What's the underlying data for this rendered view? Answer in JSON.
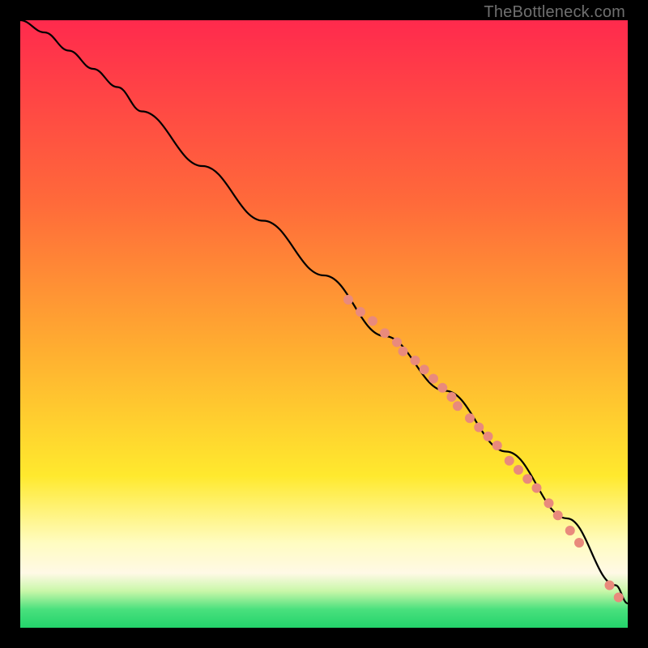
{
  "watermark": "TheBottleneck.com",
  "chart_data": {
    "type": "line",
    "title": "",
    "xlabel": "",
    "ylabel": "",
    "xlim": [
      0,
      100
    ],
    "ylim": [
      0,
      100
    ],
    "grid": false,
    "legend": false,
    "background_gradient": {
      "stops": [
        {
          "pct": 0,
          "color": "#ff2a4d"
        },
        {
          "pct": 30,
          "color": "#ff6a3a"
        },
        {
          "pct": 55,
          "color": "#ffb030"
        },
        {
          "pct": 75,
          "color": "#ffe92e"
        },
        {
          "pct": 86,
          "color": "#fffcc0"
        },
        {
          "pct": 91,
          "color": "#fff9e6"
        },
        {
          "pct": 94,
          "color": "#c8f7a8"
        },
        {
          "pct": 97,
          "color": "#49e07d"
        },
        {
          "pct": 100,
          "color": "#23d36b"
        }
      ]
    },
    "series": [
      {
        "name": "curve",
        "color": "#000000",
        "x": [
          0,
          4,
          8,
          12,
          16,
          20,
          30,
          40,
          50,
          60,
          70,
          80,
          90,
          98,
          100
        ],
        "y": [
          100,
          98,
          95,
          92,
          89,
          85,
          76,
          67,
          58,
          48,
          39,
          29,
          18,
          7,
          4
        ]
      }
    ],
    "markers": {
      "name": "highlighted-segments",
      "color": "#e98a7c",
      "radius_px": 6,
      "points": [
        {
          "x": 54,
          "y": 54
        },
        {
          "x": 56,
          "y": 52
        },
        {
          "x": 58,
          "y": 50.5
        },
        {
          "x": 60,
          "y": 48.5
        },
        {
          "x": 62,
          "y": 47
        },
        {
          "x": 63,
          "y": 45.5
        },
        {
          "x": 65,
          "y": 44
        },
        {
          "x": 66.5,
          "y": 42.5
        },
        {
          "x": 68,
          "y": 41
        },
        {
          "x": 69.5,
          "y": 39.5
        },
        {
          "x": 71,
          "y": 38
        },
        {
          "x": 72,
          "y": 36.5
        },
        {
          "x": 74,
          "y": 34.5
        },
        {
          "x": 75.5,
          "y": 33
        },
        {
          "x": 77,
          "y": 31.5
        },
        {
          "x": 78.5,
          "y": 30
        },
        {
          "x": 80.5,
          "y": 27.5
        },
        {
          "x": 82,
          "y": 26
        },
        {
          "x": 83.5,
          "y": 24.5
        },
        {
          "x": 85,
          "y": 23
        },
        {
          "x": 87,
          "y": 20.5
        },
        {
          "x": 88.5,
          "y": 18.5
        },
        {
          "x": 90.5,
          "y": 16
        },
        {
          "x": 92,
          "y": 14
        },
        {
          "x": 97,
          "y": 7
        },
        {
          "x": 98.5,
          "y": 5
        }
      ]
    }
  }
}
